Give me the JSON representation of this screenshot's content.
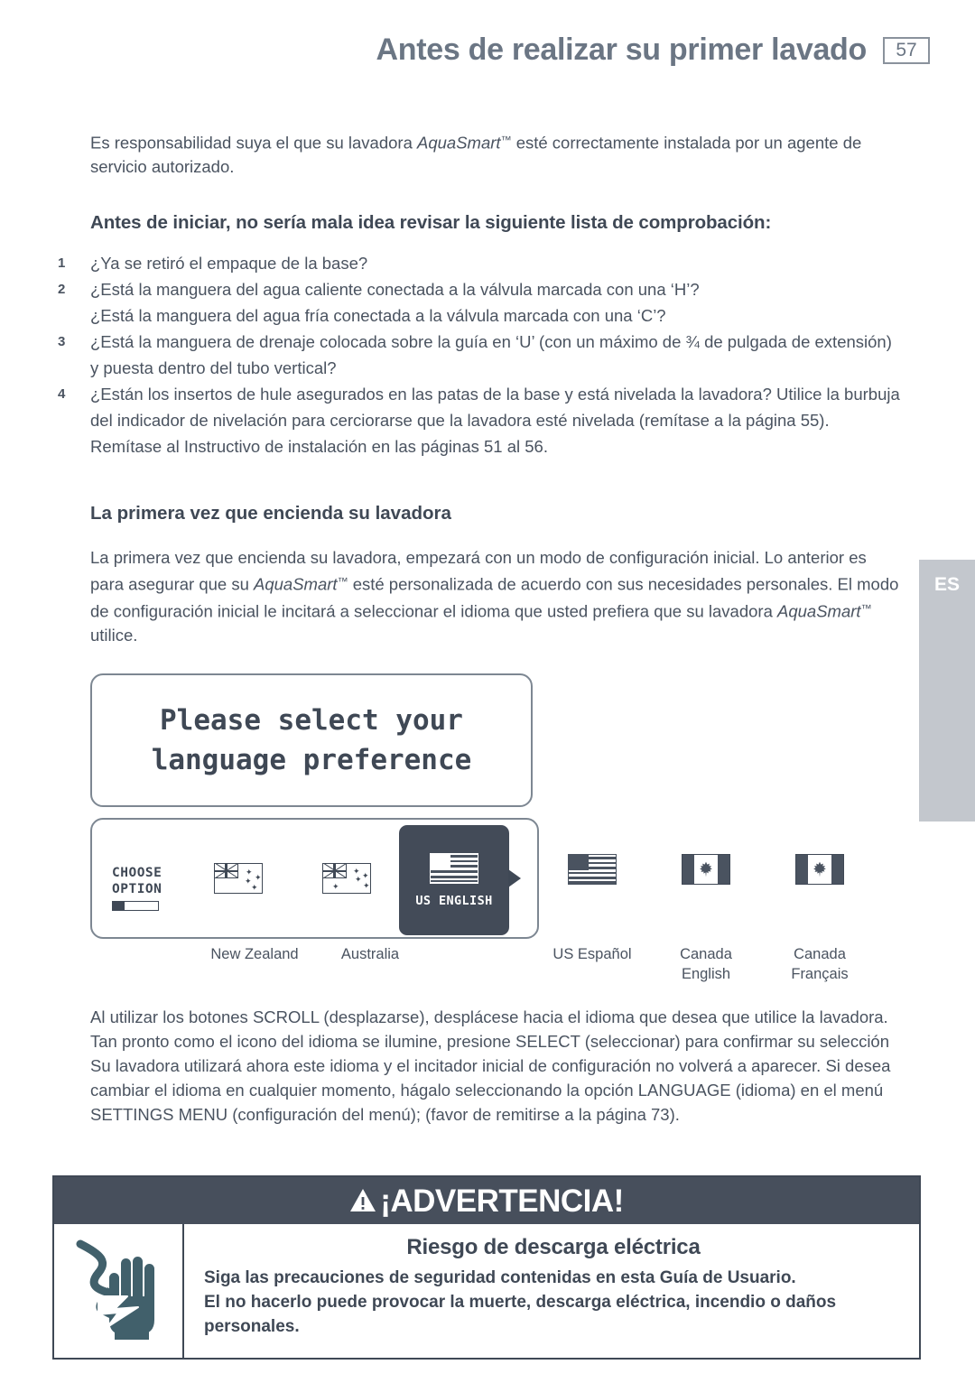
{
  "header": {
    "title": "Antes de realizar su primer lavado",
    "page_number": "57"
  },
  "side_tab": {
    "label": "ES"
  },
  "intro": {
    "line_1_a": "Es responsabilidad suya el que su lavadora ",
    "brand": "AquaSmart",
    "tm": "™",
    "line_1_b": " esté correctamente instalada por un agente de servicio autorizado."
  },
  "checklist": {
    "heading": "Antes de iniciar, no sería mala idea revisar la siguiente lista de comprobación:",
    "items": [
      {
        "num": "1",
        "text": "¿Ya se retiró el empaque de la base?",
        "sub": ""
      },
      {
        "num": "2",
        "text": "¿Está la manguera del agua caliente conectada a la válvula marcada con una ‘H’?",
        "sub": "¿Está la manguera del agua fría conectada a la válvula marcada con una ‘C’?"
      },
      {
        "num": "3",
        "text": "¿Está la manguera de drenaje colocada sobre la guía en ‘U’ (con un máximo de ¾ de pulgada de extensión) y puesta dentro del tubo vertical?",
        "sub": ""
      },
      {
        "num": "4",
        "text": "¿Están los insertos de hule asegurados en las patas de la base y está nivelada la lavadora? Utilice la burbuja del indicador de nivelación para cerciorarse que la lavadora esté nivelada (remítase a la página 55). Remítase al Instructivo de instalación en las páginas 51 al 56.",
        "sub": ""
      }
    ]
  },
  "first_use": {
    "heading": "La primera vez que encienda su lavadora",
    "para_a": "La primera vez que encienda su lavadora, empezará con un modo de configuración inicial. Lo anterior es para asegurar que su ",
    "brand": "AquaSmart",
    "tm": "™",
    "para_b": " esté personalizada de acuerdo con sus necesidades personales. El modo de configuración inicial le incitará a seleccionar el idioma que usted prefiera que su lavadora ",
    "brand2": "AquaSmart",
    "tm2": "™",
    "para_c": " utilice."
  },
  "lcd": {
    "message_line_1": "Please select your",
    "message_line_2": "language preference",
    "choose_line_1": "CHOOSE",
    "choose_line_2": "OPTION",
    "progress_percent": "26",
    "selected_tile_label": "US ENGLISH",
    "scroll_arrow": "▶"
  },
  "flag_captions": {
    "new_zealand": "New Zealand",
    "australia": "Australia",
    "us_espanol": "US Español",
    "canada_english_line1": "Canada",
    "canada_english_line2": "English",
    "canada_francais_line1": "Canada",
    "canada_francais_line2": "Français"
  },
  "scroll_para": {
    "text": "Al utilizar los botones SCROLL (desplazarse), desplácese hacia el idioma que desea que utilice la lavadora. Tan pronto como el icono del idioma se ilumine, presione SELECT (seleccionar) para confirmar su selección Su lavadora utilizará ahora este idioma y el incitador inicial de configuración no volverá a aparecer. Si desea cambiar el idioma en cualquier momento, hágalo seleccionando la opción LANGUAGE (idioma) en el menú SETTINGS MENU (configuración del menú); (favor de remitirse a la página 73)."
  },
  "warning": {
    "title": "¡ADVERTENCIA!",
    "subtitle": "Riesgo de descarga eléctrica",
    "line_1": "Siga las precauciones de seguridad contenidas en esta Guía de Usuario.",
    "line_2": "El no hacerlo puede provocar la muerte, descarga eléctrica, incendio o daños",
    "line_3": "personales."
  },
  "colors": {
    "text": "#4a5360",
    "title": "#6b7684",
    "dark": "#3f4855",
    "tile": "#434b58",
    "side_tab": "#c3c7cd"
  }
}
